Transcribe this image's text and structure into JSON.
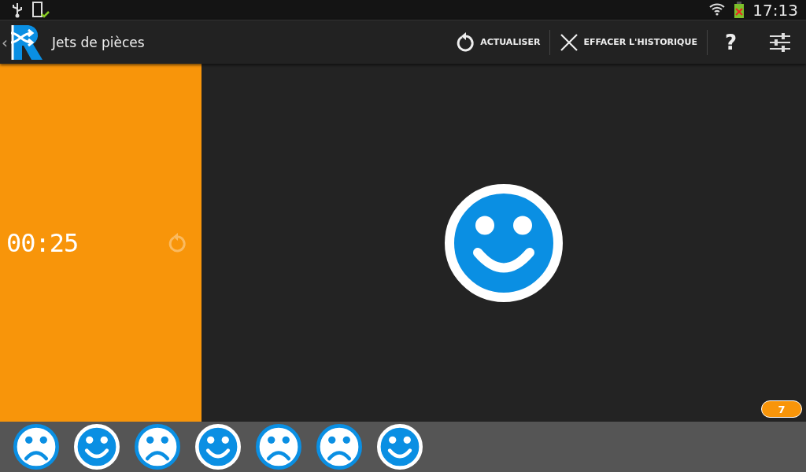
{
  "status_bar": {
    "time": "17:13"
  },
  "action_bar": {
    "back": "‹",
    "title": "Jets de pièces",
    "actions": [
      {
        "kind": "refresh",
        "label": "ACTUALISER"
      },
      {
        "kind": "clear",
        "label": "EFFACER L'HISTORIQUE"
      },
      {
        "kind": "help",
        "label": "?"
      },
      {
        "kind": "settings"
      }
    ]
  },
  "timer": {
    "time": "00:25"
  },
  "result": {
    "kind": "happy"
  },
  "history_count": "7",
  "history": [
    {
      "kind": "sad"
    },
    {
      "kind": "happy"
    },
    {
      "kind": "sad"
    },
    {
      "kind": "happy"
    },
    {
      "kind": "sad"
    },
    {
      "kind": "sad"
    },
    {
      "kind": "happy"
    }
  ]
}
